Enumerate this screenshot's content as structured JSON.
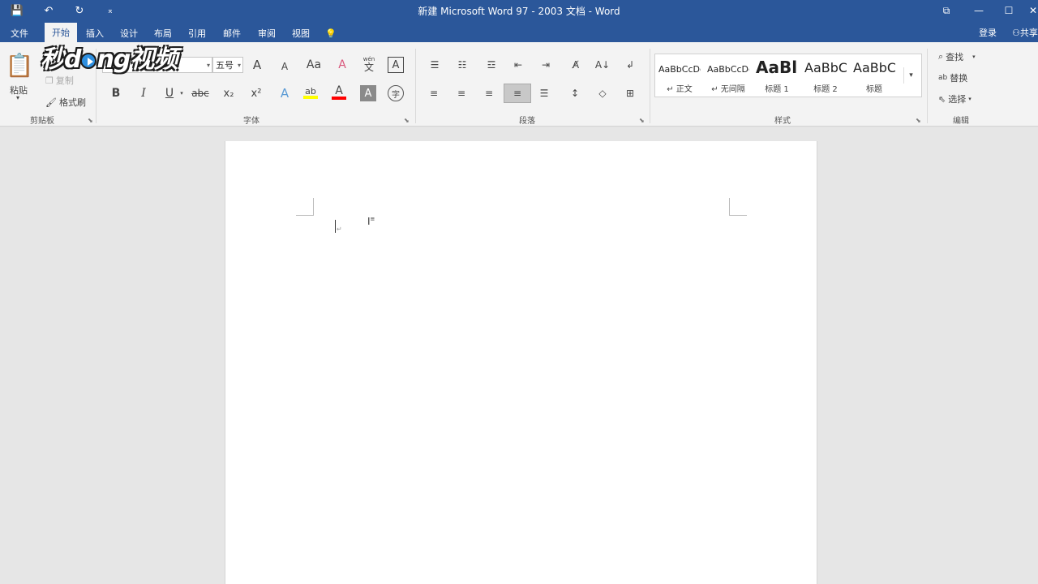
{
  "titlebar": {
    "title": "新建 Microsoft Word 97 - 2003 文档 - Word",
    "save_icon": "💾",
    "undo_icon": "↶",
    "redo_icon": "↻",
    "customize_icon": "⌅",
    "ribbon_display_icon": "⧉",
    "minimize": "—",
    "maximize": "☐",
    "close": "✕"
  },
  "tabs": {
    "file": "文件",
    "home": "开始",
    "insert": "插入",
    "design": "设计",
    "layout": "布局",
    "references": "引用",
    "mailings": "邮件",
    "review": "审阅",
    "view": "视图",
    "tell_me_icon": "💡",
    "login": "登录",
    "share": "共享"
  },
  "watermark": {
    "text_a": "秒",
    "text_b": "d",
    "text_c": "ng视频"
  },
  "clipboard": {
    "paste": "粘贴",
    "paste_arrow": "▾",
    "cut_icon": "✂",
    "copy": "复制",
    "format_painter": "格式刷",
    "label": "剪贴板"
  },
  "font": {
    "font_name": "",
    "font_size": "五号",
    "grow": "A",
    "shrink": "A",
    "change_case": "Aa",
    "clear_format": "A",
    "phonetic_top": "wén",
    "phonetic_bottom": "文",
    "char_border": "A",
    "bold": "B",
    "italic": "I",
    "underline": "U",
    "strikethrough": "abc",
    "subscript": "x₂",
    "superscript": "x²",
    "text_effects": "A",
    "highlight": "ab",
    "font_color": "A",
    "char_shading": "A",
    "enclose": "字",
    "label": "字体"
  },
  "paragraph": {
    "bullets": "☰",
    "numbering": "☷",
    "multilevel": "☲",
    "decrease_indent": "⇤",
    "increase_indent": "⇥",
    "asian_layout": "A̸",
    "sort": "A↓",
    "show_marks": "↲",
    "align_left": "≡",
    "center": "≡",
    "align_right": "≡",
    "justify": "≡",
    "distributed": "☰",
    "line_spacing": "↕",
    "shading": "◇",
    "borders": "⊞",
    "label": "段落"
  },
  "styles": {
    "items": [
      {
        "sample": "AaBbCcDc",
        "name": "↵ 正文"
      },
      {
        "sample": "AaBbCcDc",
        "name": "↵ 无间隔"
      },
      {
        "sample": "AaBl",
        "name": "标题 1"
      },
      {
        "sample": "AaBbC",
        "name": "标题 2"
      },
      {
        "sample": "AaBbC",
        "name": "标题"
      }
    ],
    "more": "▾",
    "label": "样式"
  },
  "editing": {
    "find": "查找",
    "replace": "替换",
    "select": "选择",
    "label": "编辑"
  },
  "document": {
    "para_mark": "↵"
  },
  "colors": {
    "brand": "#2b579a",
    "ribbon": "#f3f3f3",
    "highlight": "#ffff00",
    "font_color": "#ff0000"
  }
}
